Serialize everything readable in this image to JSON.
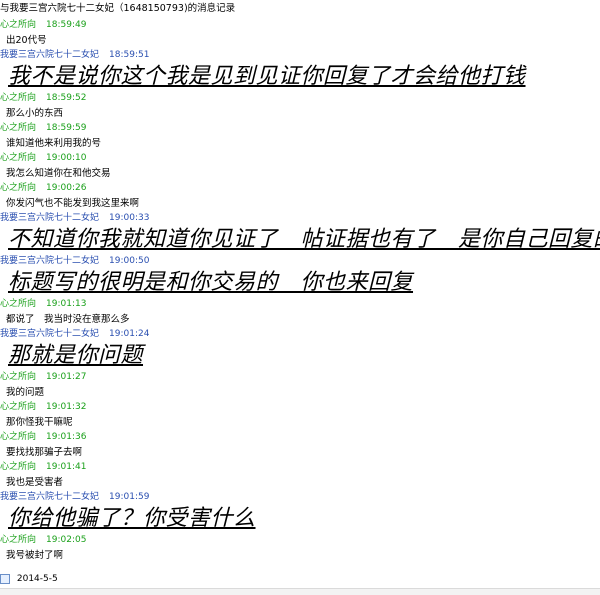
{
  "header": {
    "title": "与我要三宫六院七十二女妃（1648150793)的消息记录"
  },
  "messages": [
    {
      "sender": "心之所向",
      "time": "18:59:49",
      "side": "them",
      "text": "出20代号",
      "size": "small"
    },
    {
      "sender": "我要三宫六院七十二女妃",
      "time": "18:59:51",
      "side": "me",
      "text": "我不是说你这个我是见到见证你回复了才会给他打钱",
      "size": "big"
    },
    {
      "sender": "心之所向",
      "time": "18:59:52",
      "side": "them",
      "text": "那么小的东西",
      "size": "small"
    },
    {
      "sender": "心之所向",
      "time": "18:59:59",
      "side": "them",
      "text": "谁知道他来利用我的号",
      "size": "small"
    },
    {
      "sender": "心之所向",
      "time": "19:00:10",
      "side": "them",
      "text": "我怎么知道你在和他交易",
      "size": "small"
    },
    {
      "sender": "心之所向",
      "time": "19:00:26",
      "side": "them",
      "text": "你发闪气也不能发到我这里来啊",
      "size": "small"
    },
    {
      "sender": "我要三宫六院七十二女妃",
      "time": "19:00:33",
      "side": "me",
      "text": "不知道你我就知道你见证了　帖证据也有了　是你自己回复的",
      "size": "big"
    },
    {
      "sender": "我要三宫六院七十二女妃",
      "time": "19:00:50",
      "side": "me",
      "text": "标题写的很明是和你交易的　你也来回复",
      "size": "big"
    },
    {
      "sender": "心之所向",
      "time": "19:01:13",
      "side": "them",
      "text": "都说了　我当时没在意那么多",
      "size": "small"
    },
    {
      "sender": "我要三宫六院七十二女妃",
      "time": "19:01:24",
      "side": "me",
      "text": "那就是你问题",
      "size": "big"
    },
    {
      "sender": "心之所向",
      "time": "19:01:27",
      "side": "them",
      "text": "我的问题",
      "size": "small"
    },
    {
      "sender": "心之所向",
      "time": "19:01:32",
      "side": "them",
      "text": "那你怪我干嘛呢",
      "size": "small"
    },
    {
      "sender": "心之所向",
      "time": "19:01:36",
      "side": "them",
      "text": "要找找那骗子去啊",
      "size": "small"
    },
    {
      "sender": "心之所向",
      "time": "19:01:41",
      "side": "them",
      "text": "我也是受害者",
      "size": "small"
    },
    {
      "sender": "我要三宫六院七十二女妃",
      "time": "19:01:59",
      "side": "me",
      "text": "你给他骗了？你受害什么",
      "size": "big"
    },
    {
      "sender": "心之所向",
      "time": "19:02:05",
      "side": "them",
      "text": "我号被封了啊",
      "size": "small"
    }
  ],
  "footer": {
    "date": "2014-5-5"
  },
  "colors": {
    "them": "#1aa01a",
    "me": "#2a4fb0"
  }
}
